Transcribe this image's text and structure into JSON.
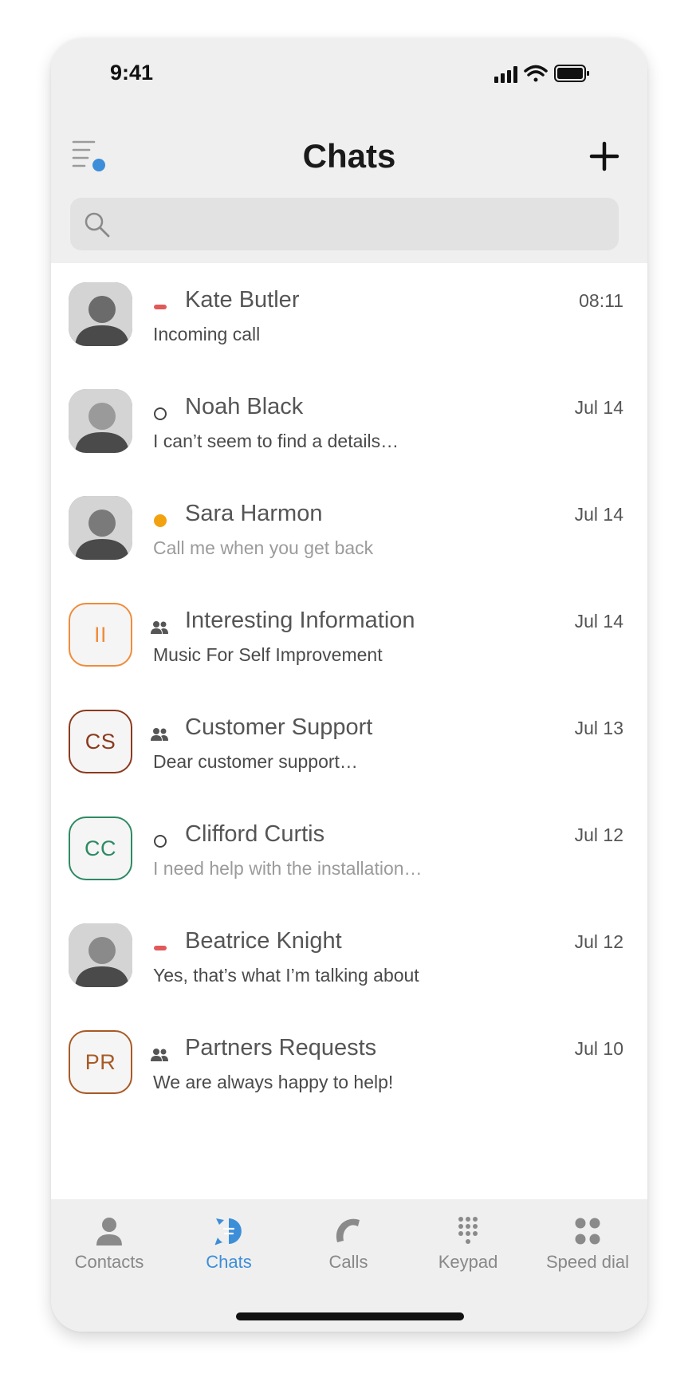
{
  "status_bar": {
    "time": "9:41"
  },
  "header": {
    "title": "Chats"
  },
  "search": {
    "placeholder": ""
  },
  "colors": {
    "accent": "#3d8ed8",
    "busy": "#e05a5a",
    "away": "#f2a20f",
    "group_icon": "#555555"
  },
  "chats": [
    {
      "name": "Kate Butler",
      "time": "08:11",
      "preview": "Incoming call",
      "status": "busy",
      "avatar": {
        "type": "photo",
        "hue": "#6b6b6b"
      },
      "muted": false
    },
    {
      "name": "Noah Black",
      "time": "Jul 14",
      "preview": "I can’t seem to find a details…",
      "status": "offline",
      "avatar": {
        "type": "photo",
        "hue": "#9a9a9a"
      },
      "muted": false
    },
    {
      "name": "Sara Harmon",
      "time": "Jul 14",
      "preview": "Call me when you get back",
      "status": "away",
      "avatar": {
        "type": "photo",
        "hue": "#7a7a7a"
      },
      "muted": true
    },
    {
      "name": "Interesting Information",
      "time": "Jul 14",
      "preview": "Music For Self Improvement",
      "status": "group",
      "avatar": {
        "type": "initials",
        "initials": "II",
        "color": "#f08c3a"
      },
      "muted": false
    },
    {
      "name": "Customer Support",
      "time": "Jul 13",
      "preview": "Dear customer support…",
      "status": "group",
      "avatar": {
        "type": "initials",
        "initials": "CS",
        "color": "#8b3a1e"
      },
      "muted": false
    },
    {
      "name": "Clifford Curtis",
      "time": "Jul 12",
      "preview": "I need help with the installation…",
      "status": "offline",
      "avatar": {
        "type": "initials",
        "initials": "CC",
        "color": "#2e8a64"
      },
      "muted": true
    },
    {
      "name": "Beatrice Knight",
      "time": "Jul 12",
      "preview": "Yes, that’s what I’m talking about",
      "status": "busy",
      "avatar": {
        "type": "photo",
        "hue": "#8a8a8a"
      },
      "muted": false
    },
    {
      "name": "Partners Requests",
      "time": "Jul 10",
      "preview": "We are always happy to help!",
      "status": "group",
      "avatar": {
        "type": "initials",
        "initials": "PR",
        "color": "#a85a25"
      },
      "muted": false
    }
  ],
  "tabbar": {
    "items": [
      {
        "label": "Contacts",
        "icon": "person-icon",
        "active": false
      },
      {
        "label": "Chats",
        "icon": "chat-bubble-icon",
        "active": true
      },
      {
        "label": "Calls",
        "icon": "phone-handset-icon",
        "active": false
      },
      {
        "label": "Keypad",
        "icon": "keypad-icon",
        "active": false
      },
      {
        "label": "Speed dial",
        "icon": "speed-dial-icon",
        "active": false
      }
    ]
  }
}
